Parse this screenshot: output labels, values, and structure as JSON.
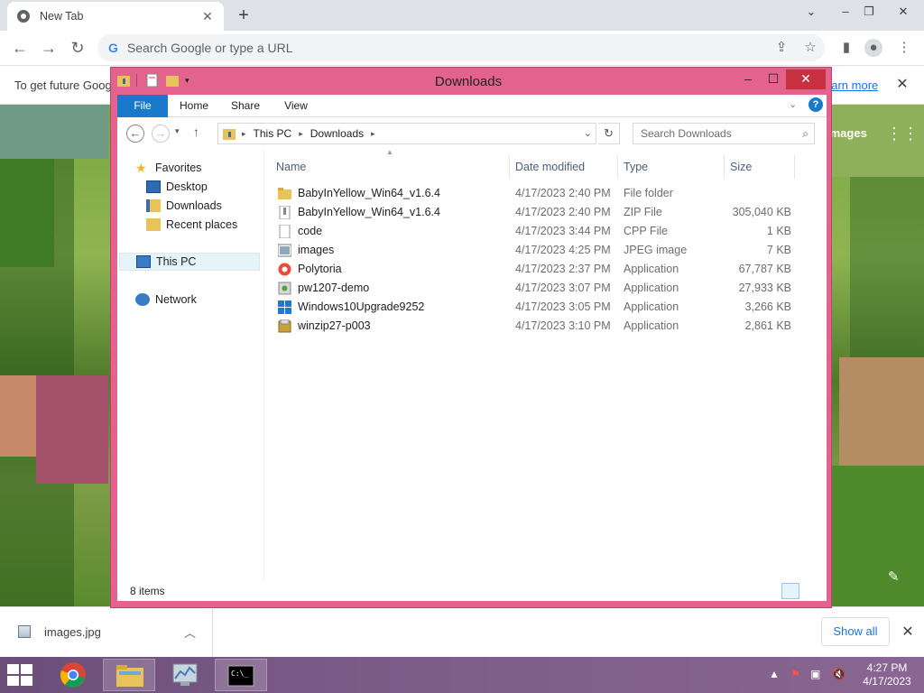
{
  "browser": {
    "tab_title": "New Tab",
    "omnibox_placeholder": "Search Google or type a URL",
    "infobar_message": "To get future Goog",
    "infobar_link": "earn more",
    "page_images_link": "Images"
  },
  "explorer": {
    "title": "Downloads",
    "ribbon_tabs": [
      "File",
      "Home",
      "Share",
      "View"
    ],
    "breadcrumb": [
      "This PC",
      "Downloads"
    ],
    "search_placeholder": "Search Downloads",
    "nav": {
      "favorites": "Favorites",
      "desktop": "Desktop",
      "downloads": "Downloads",
      "recent": "Recent places",
      "thispc": "This PC",
      "network": "Network"
    },
    "columns": {
      "name": "Name",
      "date": "Date modified",
      "type": "Type",
      "size": "Size"
    },
    "files": [
      {
        "name": "BabyInYellow_Win64_v1.6.4",
        "date": "4/17/2023 2:40 PM",
        "type": "File folder",
        "size": "",
        "icon": "folder-icon"
      },
      {
        "name": "BabyInYellow_Win64_v1.6.4",
        "date": "4/17/2023 2:40 PM",
        "type": "ZIP File",
        "size": "305,040 KB",
        "icon": "zip-file-icon"
      },
      {
        "name": "code",
        "date": "4/17/2023 3:44 PM",
        "type": "CPP File",
        "size": "1 KB",
        "icon": "text-file-icon"
      },
      {
        "name": "images",
        "date": "4/17/2023 4:25 PM",
        "type": "JPEG image",
        "size": "7 KB",
        "icon": "image-file-icon"
      },
      {
        "name": "Polytoria",
        "date": "4/17/2023 2:37 PM",
        "type": "Application",
        "size": "67,787 KB",
        "icon": "polytoria-app-icon"
      },
      {
        "name": "pw1207-demo",
        "date": "4/17/2023 3:07 PM",
        "type": "Application",
        "size": "27,933 KB",
        "icon": "installer-app-icon"
      },
      {
        "name": "Windows10Upgrade9252",
        "date": "4/17/2023 3:05 PM",
        "type": "Application",
        "size": "3,266 KB",
        "icon": "windows-app-icon"
      },
      {
        "name": "winzip27-p003",
        "date": "4/17/2023 3:10 PM",
        "type": "Application",
        "size": "2,861 KB",
        "icon": "winzip-app-icon"
      }
    ],
    "status_count": "8 items"
  },
  "shelf": {
    "download_name": "images.jpg",
    "show_all": "Show all"
  },
  "taskbar": {
    "time": "4:27 PM",
    "date": "4/17/2023"
  },
  "colors": {
    "window_frame": "#e3638e",
    "ribbon_file_tab": "#1979ca",
    "taskbar": "#7c5b87",
    "link": "#1a73e8"
  }
}
